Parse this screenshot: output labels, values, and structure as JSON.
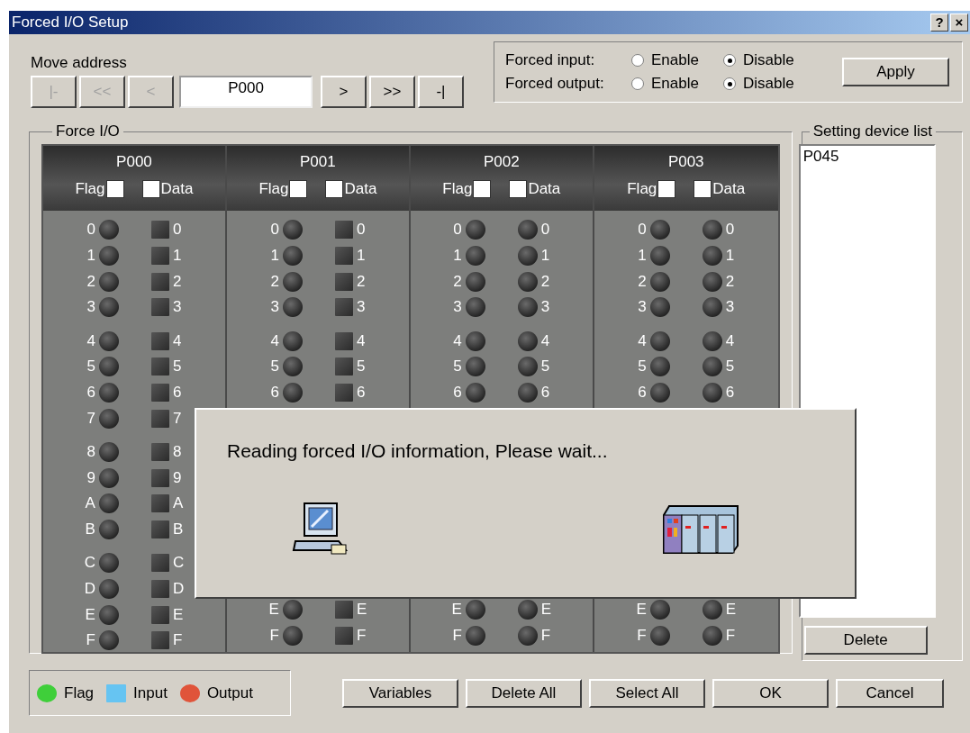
{
  "window": {
    "title": "Forced I/O Setup",
    "help": "?",
    "close": "×"
  },
  "move_address": {
    "label": "Move address",
    "value": "P000",
    "buttons": [
      {
        "label": "|-",
        "disabled": true
      },
      {
        "label": "<<",
        "disabled": true
      },
      {
        "label": "<",
        "disabled": true
      },
      {
        "label": ">",
        "disabled": false
      },
      {
        "label": ">>",
        "disabled": false
      },
      {
        "label": "-|",
        "disabled": false
      }
    ]
  },
  "forced": [
    {
      "label": "Forced input:",
      "options": [
        {
          "label": "Enable",
          "selected": false
        },
        {
          "label": "Disable",
          "selected": true
        }
      ]
    },
    {
      "label": "Forced output:",
      "options": [
        {
          "label": "Enable",
          "selected": false
        },
        {
          "label": "Disable",
          "selected": true
        }
      ]
    }
  ],
  "apply": "Apply",
  "force_io": {
    "title": "Force I/O",
    "columns": [
      {
        "name": "P000",
        "kind": "input",
        "flag_label": "Flag",
        "flag_checked": false,
        "data_label": "Data",
        "data_checked": false,
        "top_bits": [
          {
            "flag": "0",
            "data": "0"
          },
          {
            "flag": "1",
            "data": "1"
          },
          {
            "flag": "2",
            "data": "2"
          },
          {
            "flag": "3",
            "data": "3"
          },
          {
            "flag": "4",
            "data": "4"
          },
          {
            "flag": "5",
            "data": "5"
          },
          {
            "flag": "6",
            "data": "6"
          },
          {
            "flag": "7",
            "data": "7"
          },
          {
            "flag": "8",
            "data": "8"
          },
          {
            "flag": "9",
            "data": "9"
          },
          {
            "flag": "A",
            "data": "A"
          },
          {
            "flag": "B",
            "data": "B"
          },
          {
            "flag": "C",
            "data": "C"
          },
          {
            "flag": "D",
            "data": "D"
          },
          {
            "flag": "E",
            "data": "E"
          },
          {
            "flag": "F",
            "data": "F"
          }
        ]
      },
      {
        "name": "P001",
        "kind": "input",
        "flag_label": "Flag",
        "flag_checked": false,
        "data_label": "Data",
        "data_checked": false,
        "top_bits": [
          {
            "flag": "0",
            "data": "0"
          },
          {
            "flag": "1",
            "data": "1"
          },
          {
            "flag": "2",
            "data": "2"
          },
          {
            "flag": "3",
            "data": "3"
          },
          {
            "flag": "4",
            "data": "4"
          },
          {
            "flag": "5",
            "data": "5"
          },
          {
            "flag": "6",
            "data": "6"
          }
        ],
        "bottom_bits": [
          {
            "flag": "E",
            "data": "E"
          },
          {
            "flag": "F",
            "data": "F"
          }
        ]
      },
      {
        "name": "P002",
        "kind": "output",
        "flag_label": "Flag",
        "flag_checked": false,
        "data_label": "Data",
        "data_checked": false,
        "top_bits": [
          {
            "flag": "0",
            "data": "0"
          },
          {
            "flag": "1",
            "data": "1"
          },
          {
            "flag": "2",
            "data": "2"
          },
          {
            "flag": "3",
            "data": "3"
          },
          {
            "flag": "4",
            "data": "4"
          },
          {
            "flag": "5",
            "data": "5"
          },
          {
            "flag": "6",
            "data": "6"
          }
        ],
        "bottom_bits": [
          {
            "flag": "E",
            "data": "E"
          },
          {
            "flag": "F",
            "data": "F"
          }
        ]
      },
      {
        "name": "P003",
        "kind": "output",
        "flag_label": "Flag",
        "flag_checked": false,
        "data_label": "Data",
        "data_checked": false,
        "top_bits": [
          {
            "flag": "0",
            "data": "0"
          },
          {
            "flag": "1",
            "data": "1"
          },
          {
            "flag": "2",
            "data": "2"
          },
          {
            "flag": "3",
            "data": "3"
          },
          {
            "flag": "4",
            "data": "4"
          },
          {
            "flag": "5",
            "data": "5"
          },
          {
            "flag": "6",
            "data": "6"
          }
        ],
        "bottom_bits": [
          {
            "flag": "E",
            "data": "E"
          },
          {
            "flag": "F",
            "data": "F"
          }
        ]
      }
    ]
  },
  "device_list": {
    "title": "Setting device list",
    "items": [
      "P045"
    ],
    "delete": "Delete"
  },
  "legend": [
    {
      "label": "Flag",
      "kind": "circle",
      "color": "#3fcf3a"
    },
    {
      "label": "Input",
      "kind": "square",
      "color": "#66c4f2"
    },
    {
      "label": "Output",
      "kind": "circle",
      "color": "#e0543a"
    }
  ],
  "buttons": [
    "Variables",
    "Delete All",
    "Select All",
    "OK",
    "Cancel"
  ],
  "dialog": {
    "message": "Reading forced I/O information, Please wait..."
  }
}
